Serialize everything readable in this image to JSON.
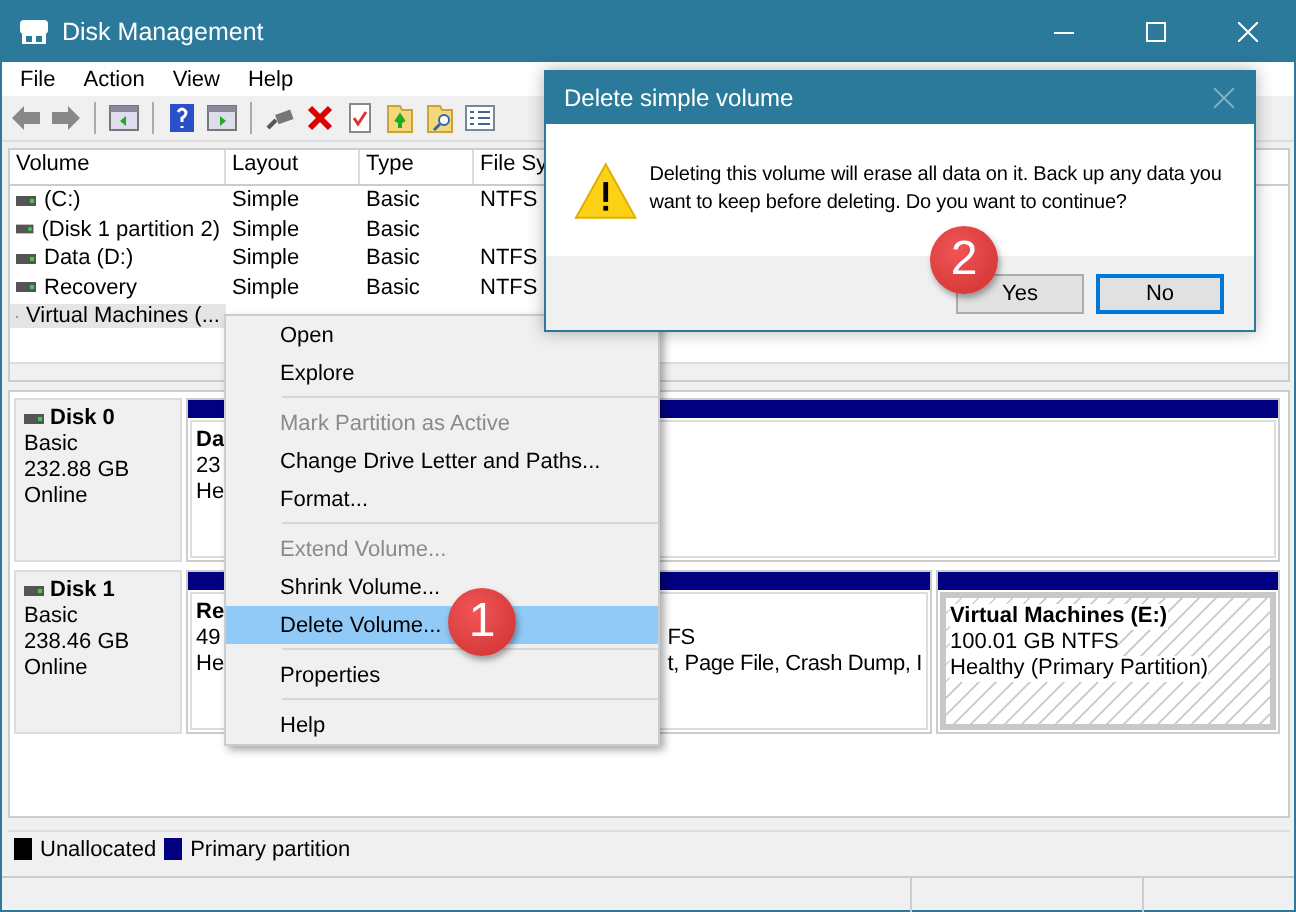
{
  "window": {
    "title": "Disk Management"
  },
  "menu": [
    "File",
    "Action",
    "View",
    "Help"
  ],
  "volume_list": {
    "columns": [
      "Volume",
      "Layout",
      "Type",
      "File Sy"
    ],
    "rows": [
      {
        "cells": [
          "(C:)",
          "Simple",
          "Basic",
          "NTFS"
        ],
        "selected": false
      },
      {
        "cells": [
          "(Disk 1 partition 2)",
          "Simple",
          "Basic"
        ],
        "selected": false
      },
      {
        "cells": [
          "Data (D:)",
          "Simple",
          "Basic",
          "NTFS"
        ],
        "selected": false
      },
      {
        "cells": [
          "Recovery",
          "Simple",
          "Basic",
          "NTFS"
        ],
        "selected": false
      },
      {
        "cells": [
          "Virtual Machines (..."
        ],
        "selected": true
      }
    ]
  },
  "disks": [
    {
      "name": "Disk 0",
      "type": "Basic",
      "size": "232.88 GB",
      "status": "Online",
      "partitions": [
        {
          "name": "Da",
          "size": "23",
          "status": "He",
          "selected": false
        }
      ]
    },
    {
      "name": "Disk 1",
      "type": "Basic",
      "size": "238.46 GB",
      "status": "Online",
      "partitions": [
        {
          "name": "Re",
          "size": "49",
          "status": "He",
          "selected": false
        },
        {
          "size": "FS",
          "status": "t, Page File, Crash Dump, I",
          "selected": false
        },
        {
          "name": "Virtual Machines  (E:)",
          "size": "100.01 GB NTFS",
          "status": "Healthy (Primary Partition)",
          "selected": true
        }
      ]
    }
  ],
  "legend": [
    {
      "label": "Unallocated",
      "color": "#000000"
    },
    {
      "label": "Primary partition",
      "color": "#000080"
    }
  ],
  "context_menu": {
    "items": [
      {
        "kind": "item",
        "label": "Open",
        "disabled": false,
        "selected": false
      },
      {
        "kind": "item",
        "label": "Explore",
        "disabled": false,
        "selected": false
      },
      {
        "kind": "separator"
      },
      {
        "kind": "item",
        "label": "Mark Partition as Active",
        "disabled": true,
        "selected": false
      },
      {
        "kind": "item",
        "label": "Change Drive Letter and Paths...",
        "disabled": false,
        "selected": false
      },
      {
        "kind": "item",
        "label": "Format...",
        "disabled": false,
        "selected": false
      },
      {
        "kind": "separator"
      },
      {
        "kind": "item",
        "label": "Extend Volume...",
        "disabled": true,
        "selected": false
      },
      {
        "kind": "item",
        "label": "Shrink Volume...",
        "disabled": false,
        "selected": false
      },
      {
        "kind": "item",
        "label": "Delete Volume...",
        "disabled": false,
        "selected": true
      },
      {
        "kind": "separator"
      },
      {
        "kind": "item",
        "label": "Properties",
        "disabled": false,
        "selected": false
      },
      {
        "kind": "separator"
      },
      {
        "kind": "item",
        "label": "Help",
        "disabled": false,
        "selected": false
      }
    ]
  },
  "dialog": {
    "title": "Delete simple volume",
    "message": "Deleting this volume will erase all data on it. Back up any data you want to keep before deleting. Do you want to continue?",
    "buttons": [
      {
        "label": "Yes",
        "focused": false
      },
      {
        "label": "No",
        "focused": true
      }
    ]
  },
  "callouts": [
    {
      "number": "1"
    },
    {
      "number": "2"
    }
  ]
}
